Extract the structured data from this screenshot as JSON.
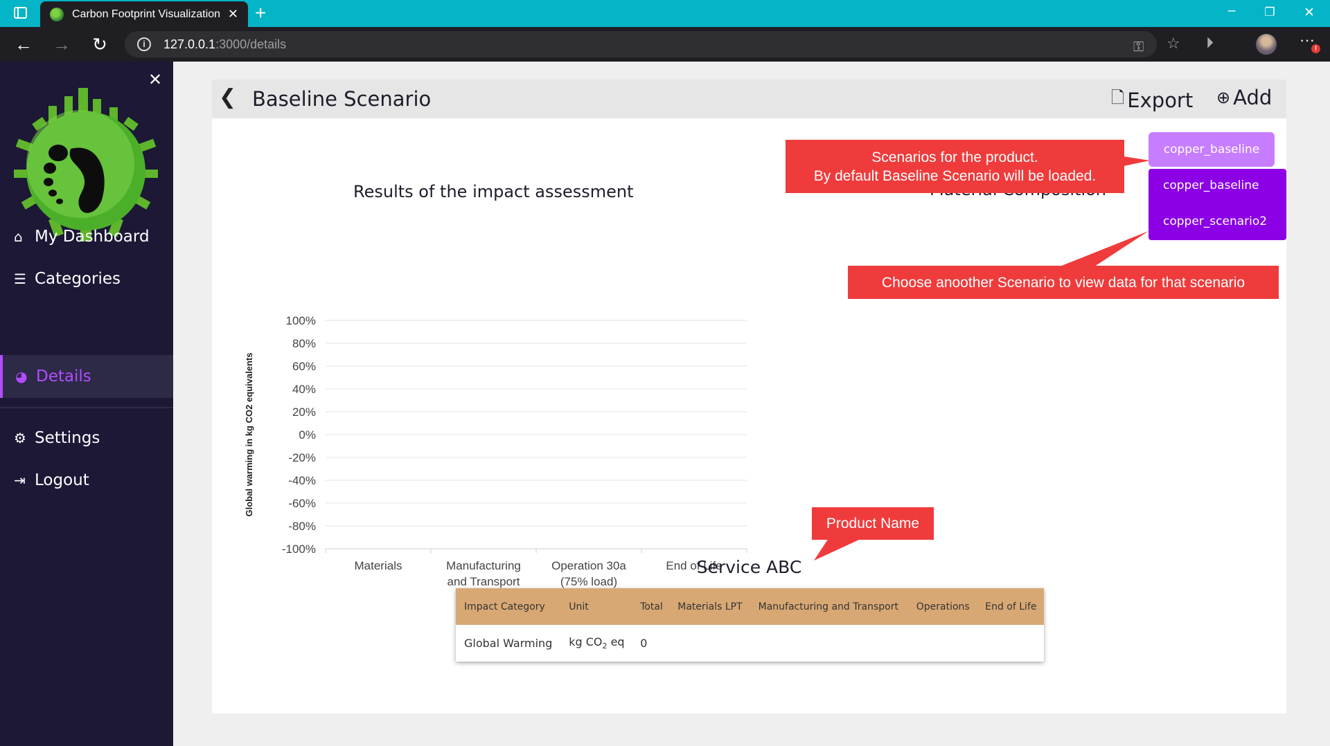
{
  "browser": {
    "tab_title": "Carbon Footprint Visualization",
    "url_host": "127.0.0.1",
    "url_path": ":3000/details"
  },
  "sidebar": {
    "items": [
      {
        "label": "My Dashboard",
        "icon": "home-icon"
      },
      {
        "label": "Categories",
        "icon": "list-icon"
      },
      {
        "label": "Details",
        "icon": "pie-chart-icon",
        "active": true
      },
      {
        "label": "Settings",
        "icon": "gears-icon"
      },
      {
        "label": "Logout",
        "icon": "sign-out-icon"
      }
    ]
  },
  "header": {
    "title": "Baseline Scenario",
    "export_label": "Export",
    "add_label": "Add"
  },
  "chart_data": {
    "type": "bar",
    "title": "Results of the impact assessment",
    "ylabel": "Global warming in kg CO2 equivalents",
    "xlabel": "",
    "categories": [
      "Materials",
      "Manufacturing and Transport",
      "Operation 30a (75% load)",
      "End of Life"
    ],
    "y_ticks": [
      "100%",
      "80%",
      "60%",
      "40%",
      "20%",
      "0%",
      "-20%",
      "-40%",
      "-60%",
      "-80%",
      "-100%"
    ],
    "ylim": [
      -100,
      100
    ],
    "grid": true,
    "series": []
  },
  "material_chart": {
    "title": "Material Composition"
  },
  "scenario": {
    "selected": "copper_baseline",
    "options": [
      "copper_baseline",
      "copper_scenario2"
    ]
  },
  "product": {
    "name": "Service ABC"
  },
  "table": {
    "headers": [
      "Impact Category",
      "Unit",
      "Total",
      "Materials LPT",
      "Manufacturing and Transport",
      "Operations",
      "End of Life"
    ],
    "rows": [
      {
        "category": "Global Warming",
        "unit_main": "kg CO",
        "unit_sub": "2",
        "unit_tail": " eq",
        "total": "0",
        "materials": "",
        "manufacturing": "",
        "operations": "",
        "end_of_life": ""
      }
    ]
  },
  "callouts": {
    "scenarios_line1": "Scenarios for the product.",
    "scenarios_line2": "By default Baseline Scenario will be loaded.",
    "choose": "Choose anoother Scenario to view data for that scenario",
    "product_name": "Product Name"
  },
  "colors": {
    "accent": "#b44cff",
    "sidebar_bg": "#1c1836",
    "callout_red": "#ef3b3b",
    "table_header": "#d8a874",
    "browser_teal": "#04b4c7"
  }
}
